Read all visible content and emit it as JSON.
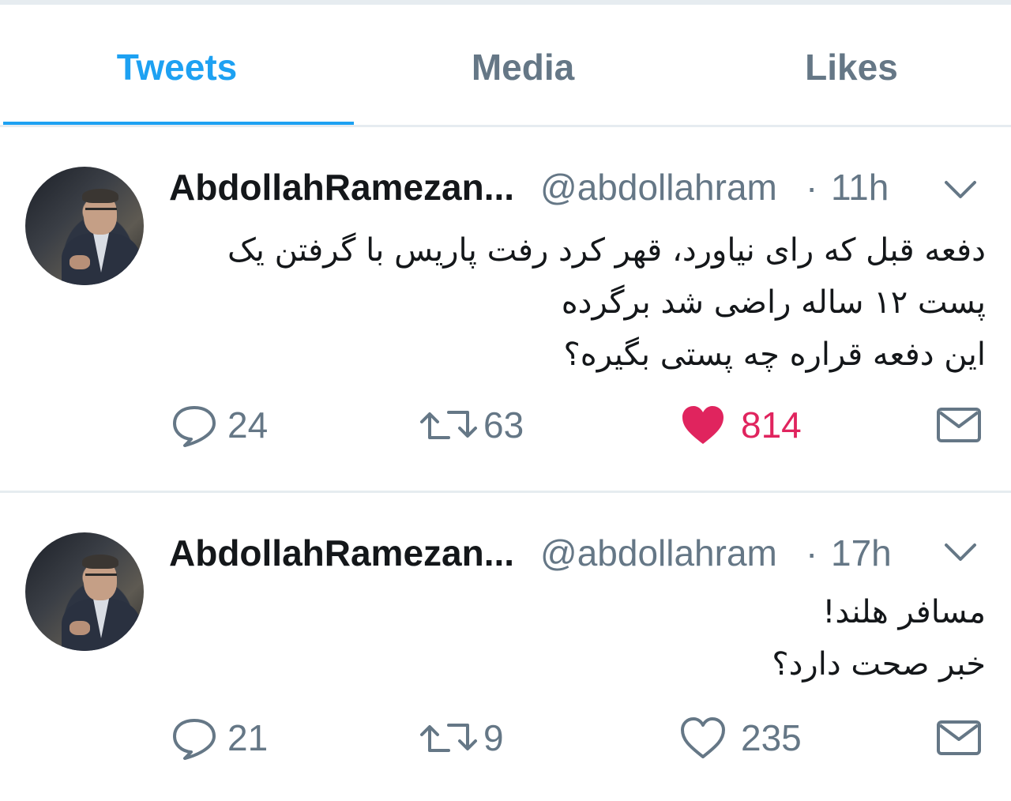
{
  "tabs": [
    {
      "label": "Tweets",
      "active": true
    },
    {
      "label": "Media",
      "active": false
    },
    {
      "label": "Likes",
      "active": false
    }
  ],
  "tweets": [
    {
      "name": "AbdollahRamezan...",
      "handle": "@abdollahram",
      "separator": "·",
      "time": "11h",
      "lines": [
        "دفعه قبل که رای نیاورد، قهر کرد رفت پاریس با گرفتن یک",
        "پست ۱۲ ساله راضی شد برگرده",
        "این دفعه قراره چه پستی بگیره؟"
      ],
      "replies": "24",
      "retweets": "63",
      "likes": "814",
      "liked": true,
      "icons": {
        "reply": "reply-icon",
        "retweet": "retweet-icon",
        "like": "heart-filled-icon",
        "dm": "envelope-icon",
        "caret": "chevron-down-icon"
      }
    },
    {
      "name": "AbdollahRamezan...",
      "handle": "@abdollahram",
      "separator": "·",
      "time": "17h",
      "lines": [
        "مسافر هلند!",
        "خبر صحت دارد؟"
      ],
      "replies": "21",
      "retweets": "9",
      "likes": "235",
      "liked": false,
      "icons": {
        "reply": "reply-icon",
        "retweet": "retweet-icon",
        "like": "heart-outline-icon",
        "dm": "envelope-icon",
        "caret": "chevron-down-icon"
      }
    }
  ],
  "colors": {
    "accent": "#1da1f2",
    "secondary_text": "#657786",
    "primary_text": "#14171a",
    "like_active": "#e0245e",
    "divider": "#e6ecf0"
  }
}
